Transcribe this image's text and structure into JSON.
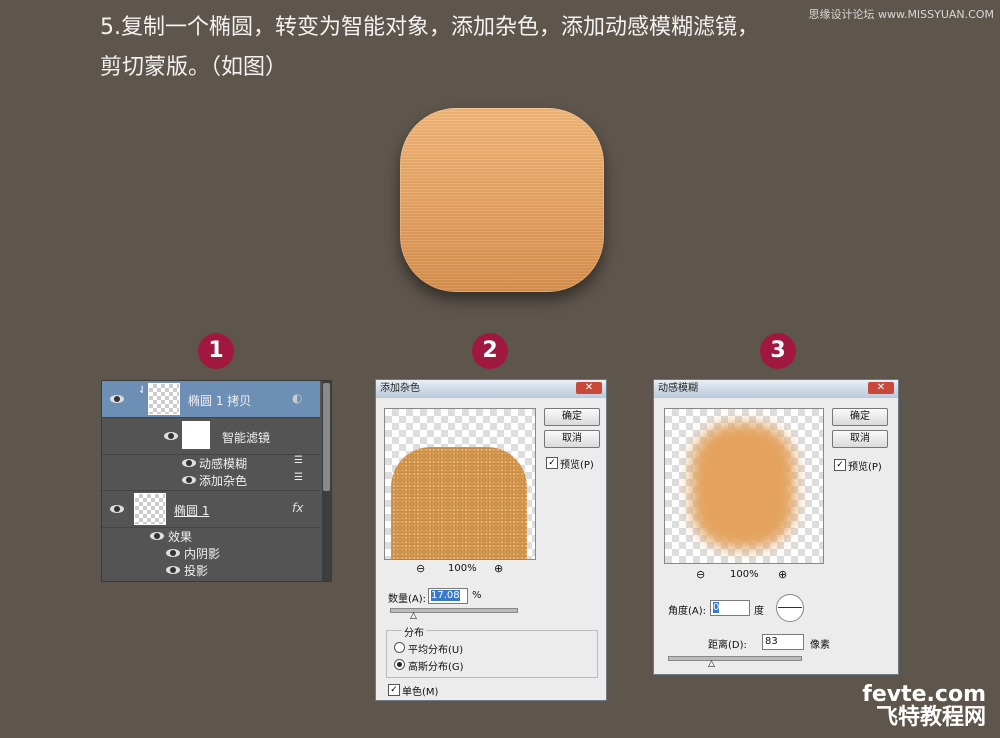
{
  "header": {
    "title_line1": "5.复制一个椭圆，转变为智能对象，添加杂色，添加动感模糊滤镜，",
    "title_line2": "剪切蒙版。（如图）",
    "watermark_top": "思缘设计论坛 www.MISSYUAN.COM"
  },
  "badges": [
    "1",
    "2",
    "3"
  ],
  "layers_panel": {
    "layer1_name": "椭圆 1 拷贝",
    "smart_filter_label": "智能滤镜",
    "filter1": "动感模糊",
    "filter2": "添加杂色",
    "layer2_name": "椭圆 1",
    "fx_label": "fx",
    "effects_label": "效果",
    "effect1": "内阴影",
    "effect2": "投影"
  },
  "add_noise_dialog": {
    "title": "添加杂色",
    "ok": "确定",
    "cancel": "取消",
    "preview": "预览(P)",
    "zoom": "100%",
    "amount_label": "数量(A):",
    "amount_value": "17.08",
    "unit": "%",
    "distribution_label": "分布",
    "uniform": "平均分布(U)",
    "gaussian": "高斯分布(G)",
    "monochromatic": "单色(M)"
  },
  "motion_blur_dialog": {
    "title": "动感模糊",
    "ok": "确定",
    "cancel": "取消",
    "preview": "预览(P)",
    "zoom": "100%",
    "angle_label": "角度(A):",
    "angle_value": "0",
    "angle_unit": "度",
    "distance_label": "距离(D):",
    "distance_value": "83",
    "distance_unit": "像素"
  },
  "footer": {
    "brand": "fevte.com",
    "brand_cn": "飞特教程网"
  },
  "colors": {
    "background": "#5e554c",
    "badge": "#a0183f",
    "wood": "#e9a867"
  }
}
